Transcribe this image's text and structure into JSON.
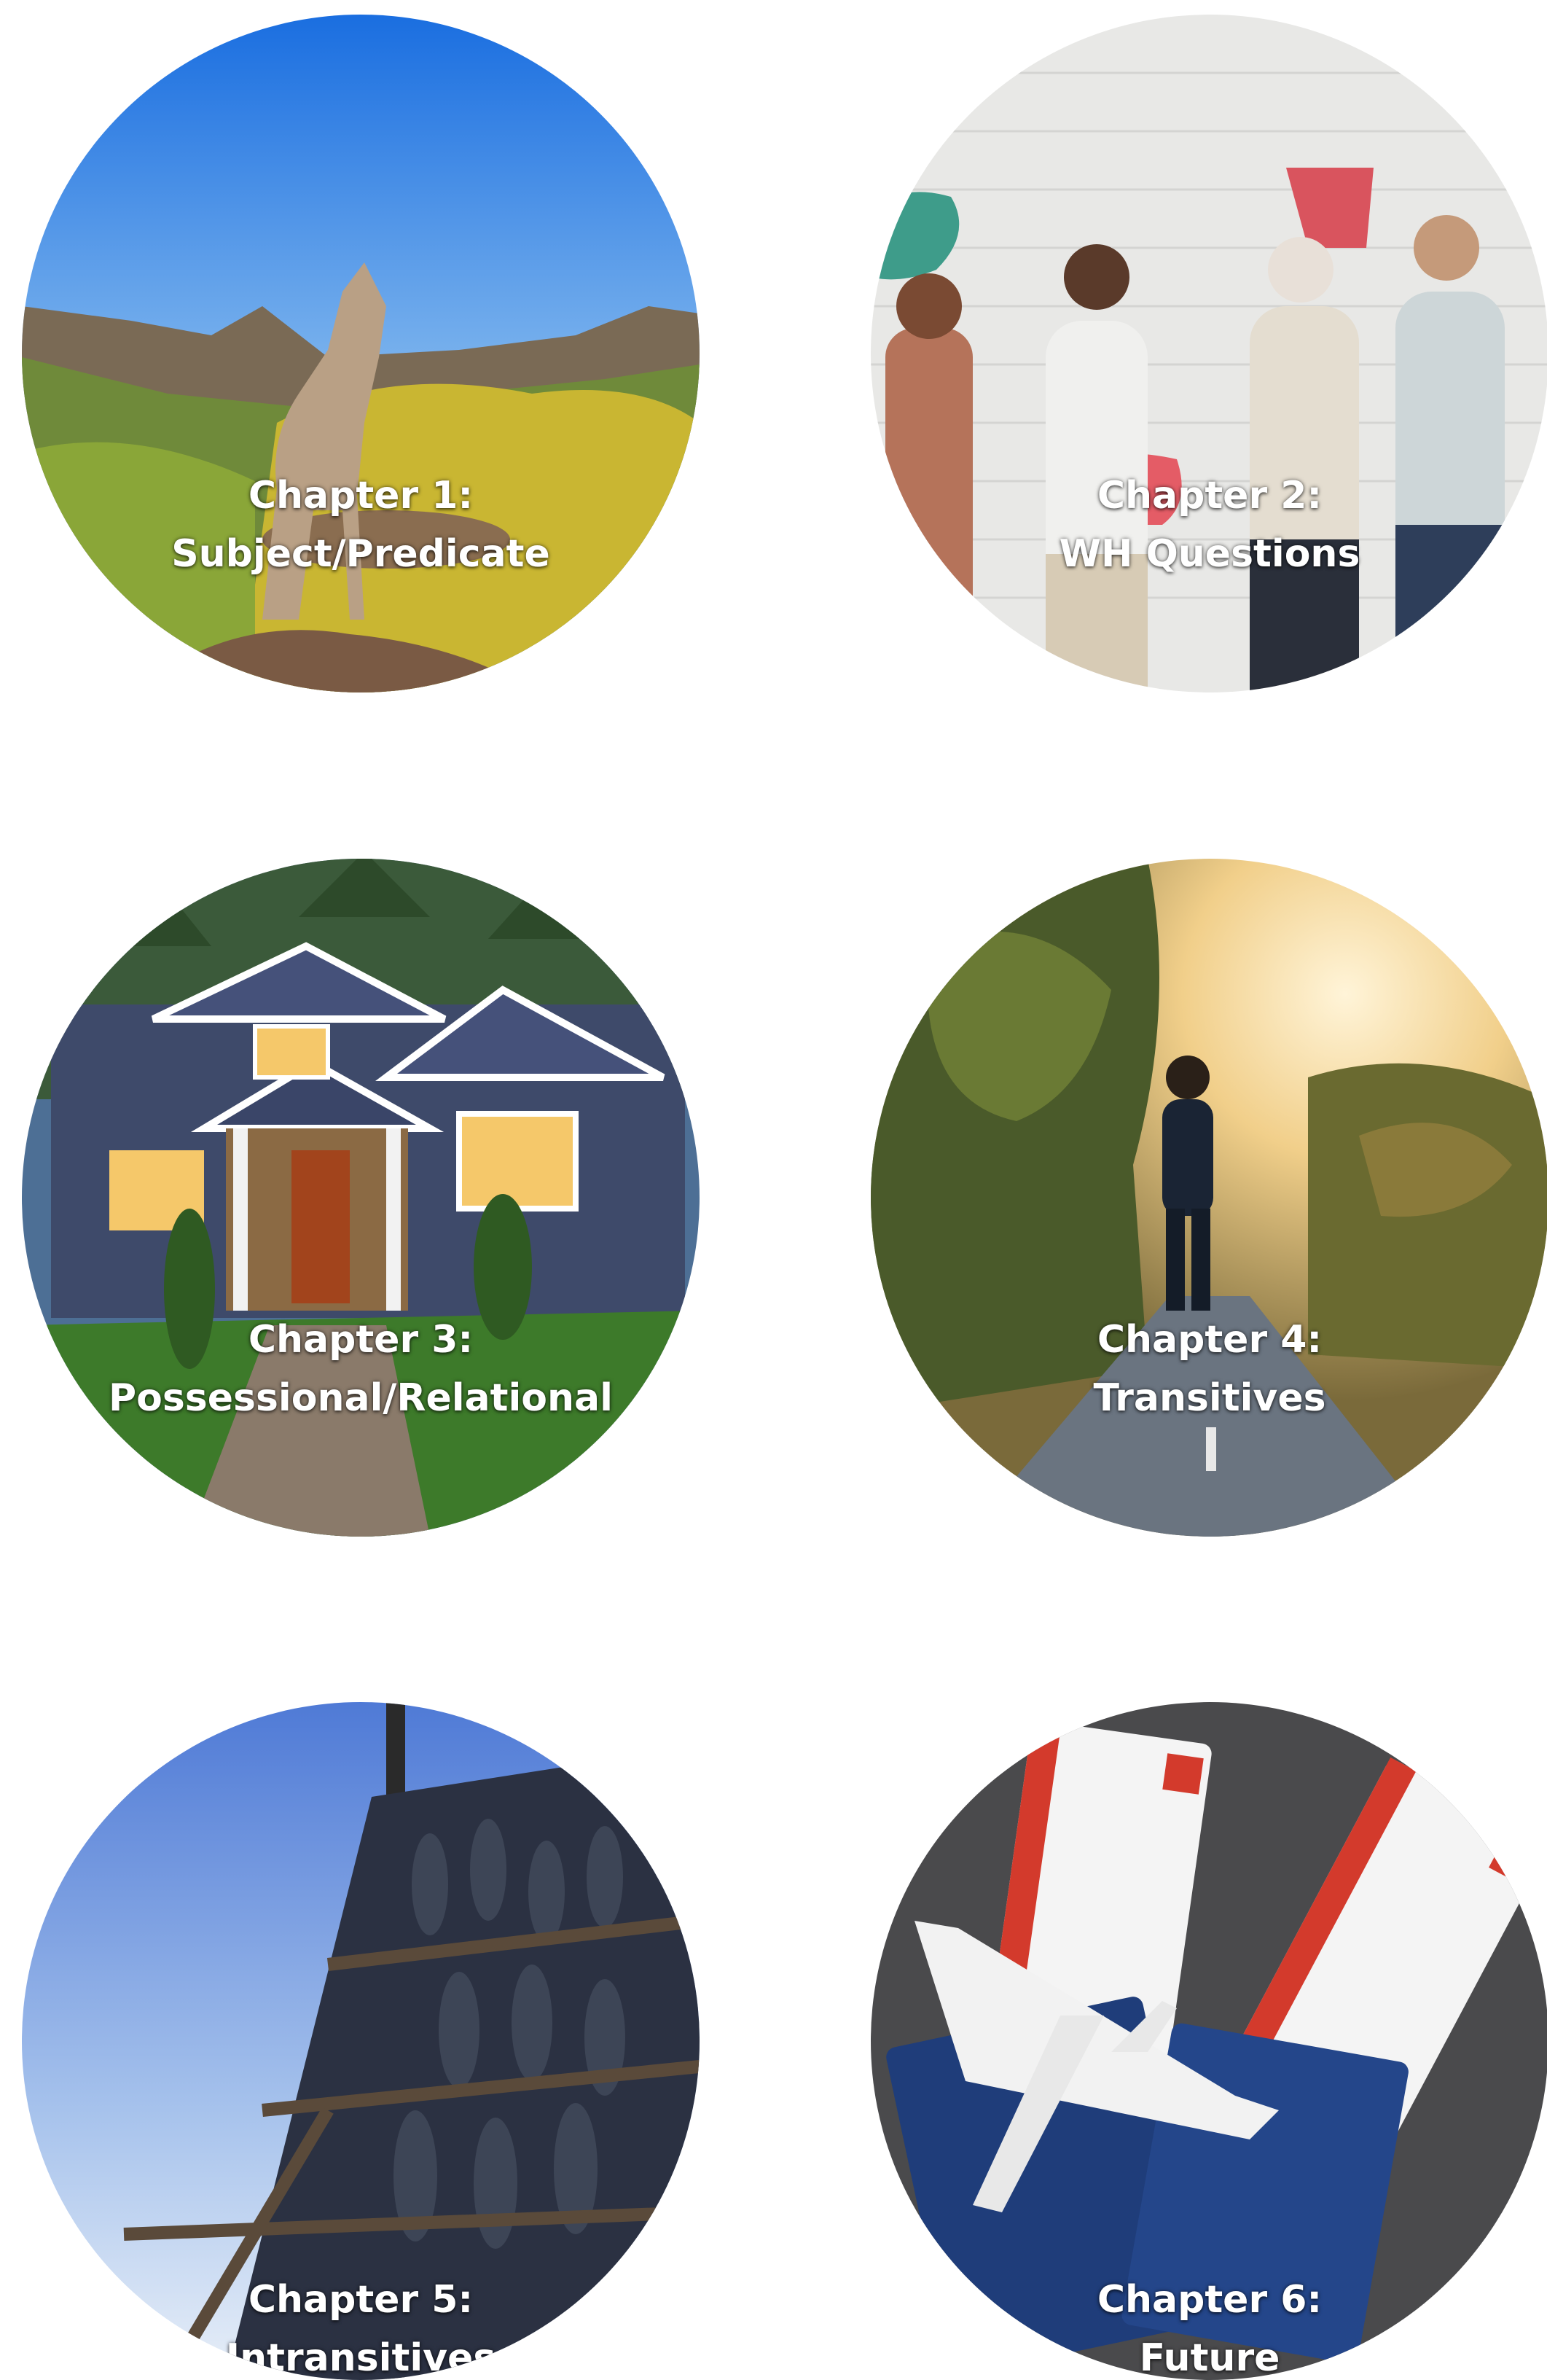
{
  "chapters": [
    {
      "line1": "Chapter 1:",
      "line2": "Subject/Predicate",
      "icon": "coyote-howling-image"
    },
    {
      "line1": "Chapter 2:",
      "line2": "WH Questions",
      "icon": "people-speech-bubbles-image"
    },
    {
      "line1": "Chapter 3:",
      "line2": "Possessional/Relational",
      "icon": "house-image"
    },
    {
      "line1": "Chapter 4:",
      "line2": "Transitives",
      "icon": "person-walking-road-image"
    },
    {
      "line1": "Chapter 5:",
      "line2": "Intransitives",
      "icon": "drying-fish-rack-image"
    },
    {
      "line1": "Chapter 6:",
      "line2": "Future",
      "icon": "boarding-pass-airplane-image"
    }
  ]
}
